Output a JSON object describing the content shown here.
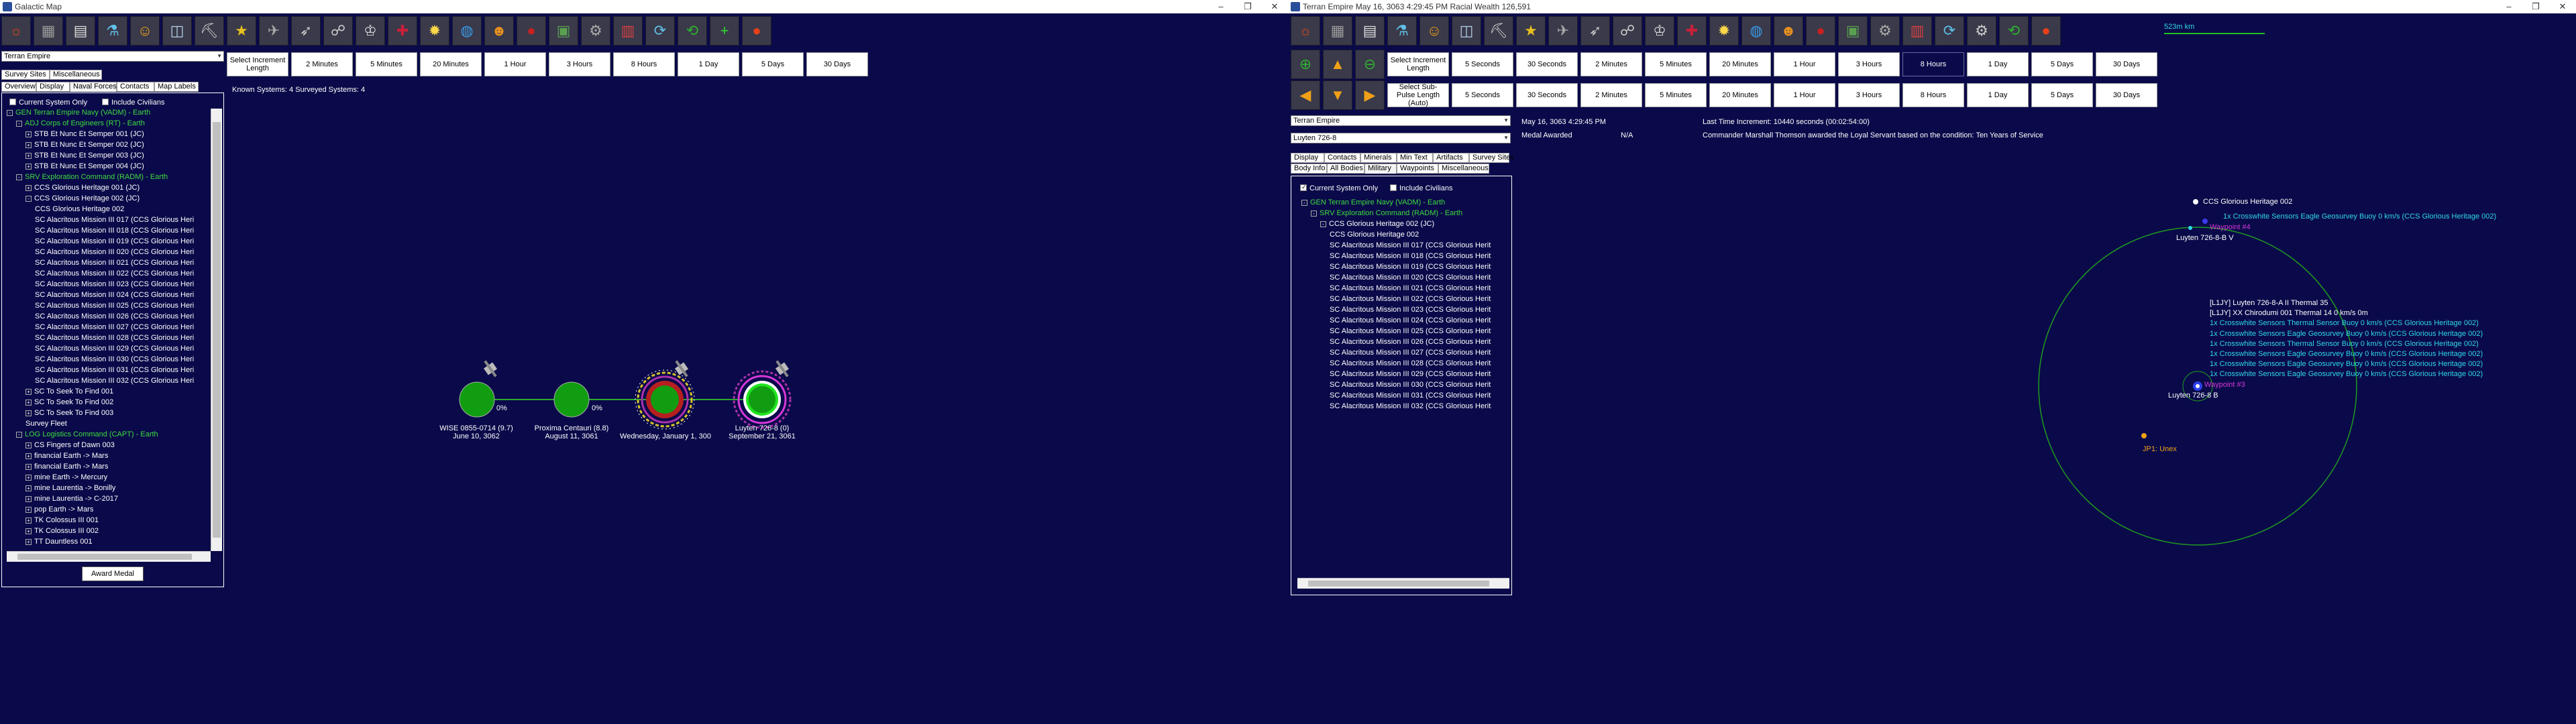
{
  "left_window": {
    "title": "Galactic Map",
    "empire_select": "Terran Empire",
    "tabs_row1": [
      "Survey Sites",
      "Miscellaneous"
    ],
    "tabs_row2": [
      "Overview",
      "Display",
      "Naval Forces",
      "Contacts",
      "Map Labels"
    ],
    "current_system_only": "Current System Only",
    "include_civilians": "Include Civilians",
    "tree": [
      {
        "text": "GEN Terran Empire Navy (VADM) - Earth",
        "level": 0,
        "green": true,
        "exp": "-"
      },
      {
        "text": "ADJ Corps of Engineers (RT) - Earth",
        "level": 1,
        "green": true,
        "exp": "-"
      },
      {
        "text": "STB Et Nunc Et Semper 001 (JC)",
        "level": 2,
        "exp": "+"
      },
      {
        "text": "STB Et Nunc Et Semper 002 (JC)",
        "level": 2,
        "exp": "+"
      },
      {
        "text": "STB Et Nunc Et Semper 003 (JC)",
        "level": 2,
        "exp": "+"
      },
      {
        "text": "STB Et Nunc Et Semper 004 (JC)",
        "level": 2,
        "exp": "+"
      },
      {
        "text": "SRV Exploration Command (RADM) - Earth",
        "level": 1,
        "green": true,
        "exp": "-"
      },
      {
        "text": "CCS Glorious Heritage 001 (JC)",
        "level": 2,
        "exp": "+"
      },
      {
        "text": "CCS Glorious Heritage 002 (JC)",
        "level": 2,
        "exp": "-"
      },
      {
        "text": "CCS Glorious Heritage 002",
        "level": 3
      },
      {
        "text": "SC Alacritous Mission III 017 (CCS Glorious Heri",
        "level": 3
      },
      {
        "text": "SC Alacritous Mission III 018 (CCS Glorious Heri",
        "level": 3
      },
      {
        "text": "SC Alacritous Mission III 019 (CCS Glorious Heri",
        "level": 3
      },
      {
        "text": "SC Alacritous Mission III 020 (CCS Glorious Heri",
        "level": 3
      },
      {
        "text": "SC Alacritous Mission III 021 (CCS Glorious Heri",
        "level": 3
      },
      {
        "text": "SC Alacritous Mission III 022 (CCS Glorious Heri",
        "level": 3
      },
      {
        "text": "SC Alacritous Mission III 023 (CCS Glorious Heri",
        "level": 3
      },
      {
        "text": "SC Alacritous Mission III 024 (CCS Glorious Heri",
        "level": 3
      },
      {
        "text": "SC Alacritous Mission III 025 (CCS Glorious Heri",
        "level": 3
      },
      {
        "text": "SC Alacritous Mission III 026 (CCS Glorious Heri",
        "level": 3
      },
      {
        "text": "SC Alacritous Mission III 027 (CCS Glorious Heri",
        "level": 3
      },
      {
        "text": "SC Alacritous Mission III 028 (CCS Glorious Heri",
        "level": 3
      },
      {
        "text": "SC Alacritous Mission III 029 (CCS Glorious Heri",
        "level": 3
      },
      {
        "text": "SC Alacritous Mission III 030 (CCS Glorious Heri",
        "level": 3
      },
      {
        "text": "SC Alacritous Mission III 031 (CCS Glorious Heri",
        "level": 3
      },
      {
        "text": "SC Alacritous Mission III 032 (CCS Glorious Heri",
        "level": 3
      },
      {
        "text": "SC To Seek To Find 001",
        "level": 2,
        "exp": "+"
      },
      {
        "text": "SC To Seek To Find 002",
        "level": 2,
        "exp": "+"
      },
      {
        "text": "SC To Seek To Find 003",
        "level": 2,
        "exp": "+"
      },
      {
        "text": "Survey Fleet",
        "level": 2
      },
      {
        "text": "LOG Logistics Command (CAPT) - Earth",
        "level": 1,
        "green": true,
        "exp": "-"
      },
      {
        "text": "CS Fingers of Dawn 003",
        "level": 2,
        "exp": "+"
      },
      {
        "text": "financial Earth -> Mars",
        "level": 2,
        "exp": "+"
      },
      {
        "text": "financial Earth -> Mars",
        "level": 2,
        "exp": "+"
      },
      {
        "text": "mine Earth -> Mercury",
        "level": 2,
        "exp": "+"
      },
      {
        "text": "mine Laurentia -> Bonilly",
        "level": 2,
        "exp": "+"
      },
      {
        "text": "mine Laurentia -> C-2017",
        "level": 2,
        "exp": "+"
      },
      {
        "text": "pop Earth -> Mars",
        "level": 2,
        "exp": "+"
      },
      {
        "text": "TK Colossus III 001",
        "level": 2,
        "exp": "+"
      },
      {
        "text": "TK Colossus III 002",
        "level": 2,
        "exp": "+"
      },
      {
        "text": "TT Dauntless 001",
        "level": 2,
        "exp": "+"
      }
    ],
    "award_button": "Award Medal",
    "increment_label": "Select Increment Length",
    "time_buttons": [
      "2 Minutes",
      "5 Minutes",
      "20 Minutes",
      "1 Hour",
      "3 Hours",
      "8 Hours",
      "1 Day",
      "5 Days",
      "30 Days"
    ],
    "known_systems": "Known Systems: 4   Surveyed Systems: 4",
    "systems": [
      {
        "name": "WISE 0855-0714",
        "sub": "(9.7)",
        "date": "June 10, 3062",
        "pct": "0%"
      },
      {
        "name": "Proxima Centauri",
        "sub": "(8.8)",
        "date": "August 11, 3061",
        "pct": "0%"
      },
      {
        "name": "",
        "sub": "",
        "date": "Wednesday, January 1, 300",
        "pct": ""
      },
      {
        "name": "Luyten 726-8",
        "sub": "(0)",
        "date": "September 21, 3061",
        "pct": ""
      }
    ]
  },
  "right_window": {
    "title": "Terran Empire   May 16, 3063 4:29:45 PM   Racial Wealth 126,591",
    "increment_label": "Select Increment Length",
    "time_buttons": [
      "5 Seconds",
      "30 Seconds",
      "2 Minutes",
      "5 Minutes",
      "20 Minutes",
      "1 Hour",
      "3 Hours",
      "8 Hours",
      "1 Day",
      "5 Days",
      "30 Days"
    ],
    "subpulse_label": "Select Sub-Pulse Length (Auto)",
    "scale": "523m km",
    "empire_select": "Terran Empire",
    "system_select": "Luyten 726-8",
    "tabs_row1": [
      "Display",
      "Contacts",
      "Minerals",
      "Min Text",
      "Artifacts",
      "Survey Sites"
    ],
    "tabs_row2": [
      "Body Info",
      "All Bodies",
      "Military",
      "Waypoints",
      "Miscellaneous"
    ],
    "current_system_only": "Current System Only",
    "include_civilians": "Include Civilians",
    "event_date": "May 16, 3063 4:29:45 PM",
    "event_type": "Medal Awarded",
    "event_na": "N/A",
    "last_increment": "Last Time Increment: 10440 seconds (00:02:54:00)",
    "event_text": "Commander Marshall Thomson awarded the Loyal Servant based on the condition: Ten Years of Service",
    "tree": [
      {
        "text": "GEN Terran Empire Navy (VADM) - Earth",
        "level": 0,
        "green": true,
        "exp": "-"
      },
      {
        "text": "SRV Exploration Command (RADM) - Earth",
        "level": 1,
        "green": true,
        "exp": "-"
      },
      {
        "text": "CCS Glorious Heritage 002 (JC)",
        "level": 2,
        "exp": "-"
      },
      {
        "text": "CCS Glorious Heritage 002",
        "level": 3
      },
      {
        "text": "SC Alacritous Mission III 017 (CCS Glorious Herit",
        "level": 3
      },
      {
        "text": "SC Alacritous Mission III 018 (CCS Glorious Herit",
        "level": 3
      },
      {
        "text": "SC Alacritous Mission III 019 (CCS Glorious Herit",
        "level": 3
      },
      {
        "text": "SC Alacritous Mission III 020 (CCS Glorious Herit",
        "level": 3
      },
      {
        "text": "SC Alacritous Mission III 021 (CCS Glorious Herit",
        "level": 3
      },
      {
        "text": "SC Alacritous Mission III 022 (CCS Glorious Herit",
        "level": 3
      },
      {
        "text": "SC Alacritous Mission III 023 (CCS Glorious Herit",
        "level": 3
      },
      {
        "text": "SC Alacritous Mission III 024 (CCS Glorious Herit",
        "level": 3
      },
      {
        "text": "SC Alacritous Mission III 025 (CCS Glorious Herit",
        "level": 3
      },
      {
        "text": "SC Alacritous Mission III 026 (CCS Glorious Herit",
        "level": 3
      },
      {
        "text": "SC Alacritous Mission III 027 (CCS Glorious Herit",
        "level": 3
      },
      {
        "text": "SC Alacritous Mission III 028 (CCS Glorious Herit",
        "level": 3
      },
      {
        "text": "SC Alacritous Mission III 029 (CCS Glorious Herit",
        "level": 3
      },
      {
        "text": "SC Alacritous Mission III 030 (CCS Glorious Herit",
        "level": 3
      },
      {
        "text": "SC Alacritous Mission III 031 (CCS Glorious Herit",
        "level": 3
      },
      {
        "text": "SC Alacritous Mission III 032 (CCS Glorious Herit",
        "level": 3
      }
    ],
    "map": {
      "ccs_label": "CCS Glorious Heritage 002",
      "waypoint": "Waypoint #4",
      "luyten_v": "Luyten 726-8-B V",
      "luyten_b": "Luyten 726-8 B",
      "waypoint3": "Waypoint #3",
      "jp": "JP1: Unex",
      "contacts": [
        {
          "text": "1x Crosswhite Sensors Eagle Geosurvey Buoy  0 km/s (CCS Glorious Heritage 002)"
        },
        {
          "text": "[L1JY] Luyten 726-8-A II   Thermal 35"
        },
        {
          "text": "[L1JY] XX Chirodumi 001   Thermal 14   0 km/s  0m"
        },
        {
          "text": "1x Crosswhite Sensors Thermal Sensor Buoy  0 km/s (CCS Glorious Heritage 002)"
        },
        {
          "text": "1x Crosswhite Sensors Eagle Geosurvey Buoy  0 km/s (CCS Glorious Heritage 002)"
        },
        {
          "text": "1x Crosswhite Sensors Thermal Sensor Buoy  0 km/s (CCS Glorious Heritage 002)"
        },
        {
          "text": "1x Crosswhite Sensors Eagle Geosurvey Buoy  0 km/s (CCS Glorious Heritage 002)"
        },
        {
          "text": "1x Crosswhite Sensors Eagle Geosurvey Buoy  0 km/s (CCS Glorious Heritage 002)"
        },
        {
          "text": "1x Crosswhite Sensors Eagle Geosurvey Buoy  0 km/s (CCS Glorious Heritage 002)"
        }
      ]
    }
  }
}
